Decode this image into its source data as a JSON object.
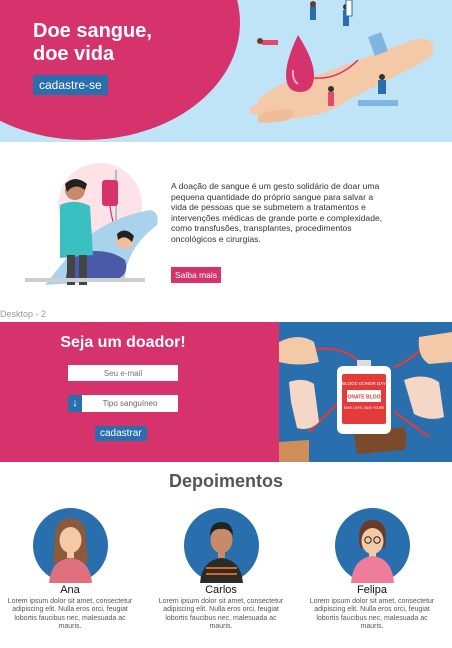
{
  "hero": {
    "title_line1": "Doe sangue,",
    "title_line2": "doe vida",
    "cta_label": "cadastre-se"
  },
  "info": {
    "text": "A doação de sangue é um gesto solidário de doar uma pequena quantidade do próprio sangue para salvar a vida de pessoas que se submetem a tratamentos e intervenções médicas de grande porte e complexidade, como transfusões, transplantes, procedimentos oncológicos e cirurgias.",
    "button_label": "Saiba mais"
  },
  "frame_label": "Desktop - 2",
  "donor": {
    "title": "Seja um doador!",
    "email_placeholder": "Seu e-mail",
    "blood_type_placeholder": "Tipo sanguíneo",
    "submit_label": "cadastrar",
    "bag_line1": "BLOOD DONOR DAY",
    "bag_line2": "DONATE BLOOD",
    "bag_line3": "SAVE LIVES, SAVE YOURS"
  },
  "testimonials": {
    "title": "Depoimentos",
    "people": [
      {
        "name": "Ana",
        "text": "Lorem ipsum dolor sit amet, consectetur adipiscing elit. Nulla eros orci, feugiat lobortis faucibus nec, malesuada ac mauris."
      },
      {
        "name": "Carlos",
        "text": "Lorem ipsum dolor sit amet, consectetur adipiscing elit. Nulla eros orci, feugiat lobortis faucibus nec, malesuada ac mauris."
      },
      {
        "name": "Felipa",
        "text": "Lorem ipsum dolor sit amet, consectetur adipiscing elit. Nulla eros orci, feugiat lobortis faucibus nec, malesuada ac mauris."
      }
    ]
  },
  "colors": {
    "primary_pink": "#d6336c",
    "primary_blue": "#2a6fad",
    "hero_bg": "#bfe3f7"
  },
  "icons": {
    "blood_type_arrow": "arrow-down-icon"
  }
}
